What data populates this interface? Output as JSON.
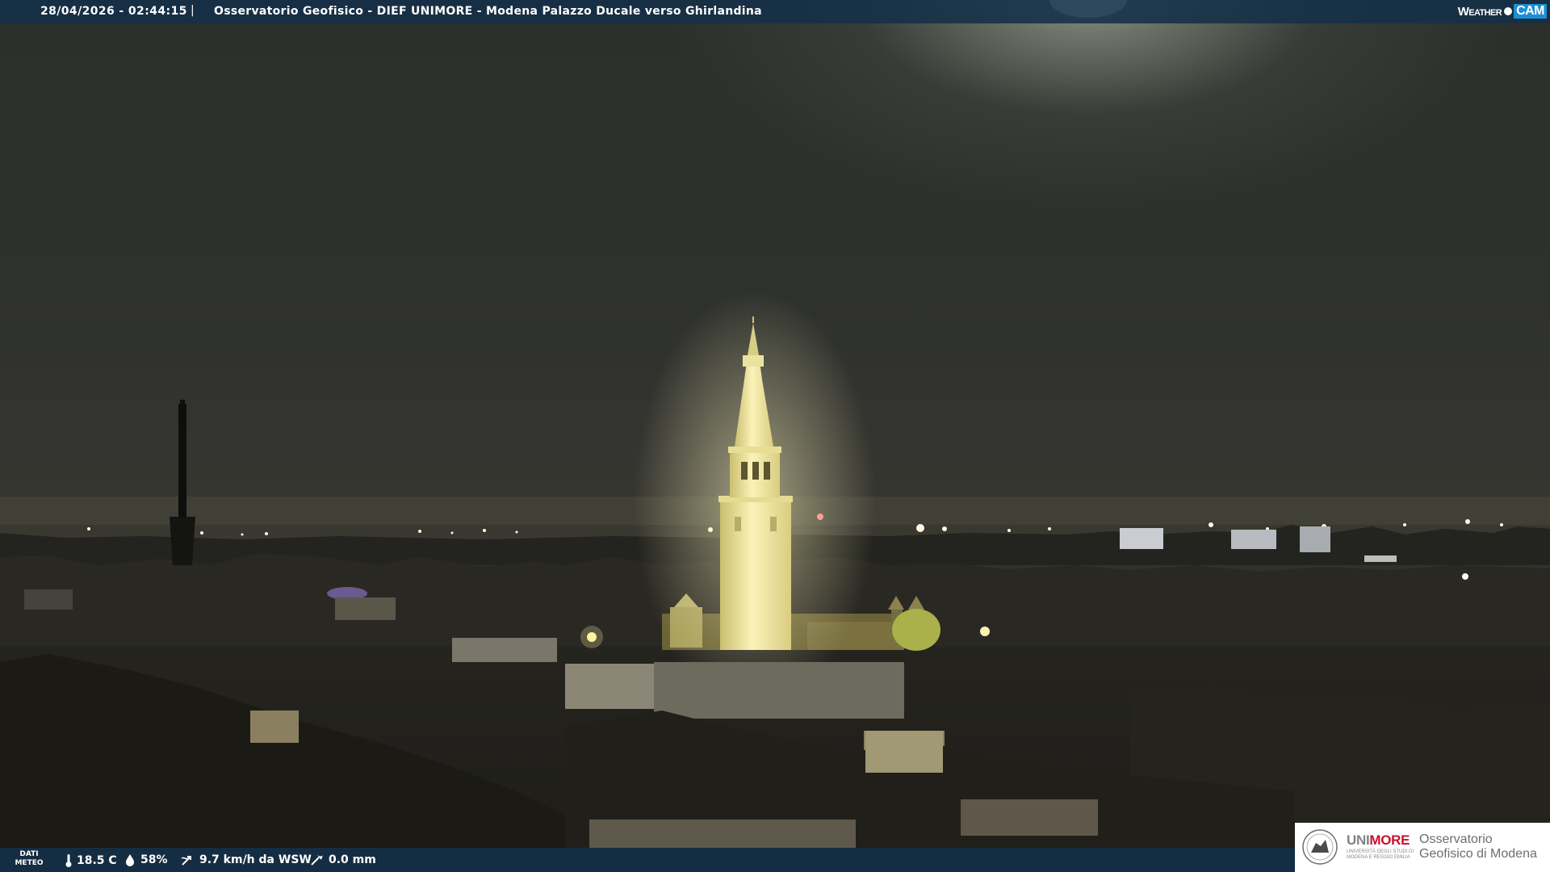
{
  "header": {
    "timestamp": "28/04/2026 - 02:44:15",
    "separator": "|",
    "camera_title": "Osservatorio Geofisico - DIEF UNIMORE - Modena Palazzo Ducale verso Ghirlandina",
    "brand_weather": "Weather",
    "brand_cam": "CAM"
  },
  "weather": {
    "label": "DATI METEO",
    "temperature": "18.5 C",
    "humidity": "58%",
    "wind": "9.7 km/h da WSW",
    "rain": "0.0 mm",
    "icons": [
      "thermometer-icon",
      "humidity-drop-icon",
      "wind-icon",
      "rain-gauge-icon"
    ]
  },
  "logo": {
    "university_prefix": "UNI",
    "university_suffix": "MORE",
    "university_full": "UNIVERSITÀ DEGLI STUDI DI MODENA E REGGIO EMILIA",
    "observatory": "Osservatorio Geofisico di Modena"
  },
  "colors": {
    "bar": "#143048",
    "brand_accent": "#1c8fd6",
    "unimore_red": "#c8102e",
    "tower_light": "#f3eaa8"
  }
}
